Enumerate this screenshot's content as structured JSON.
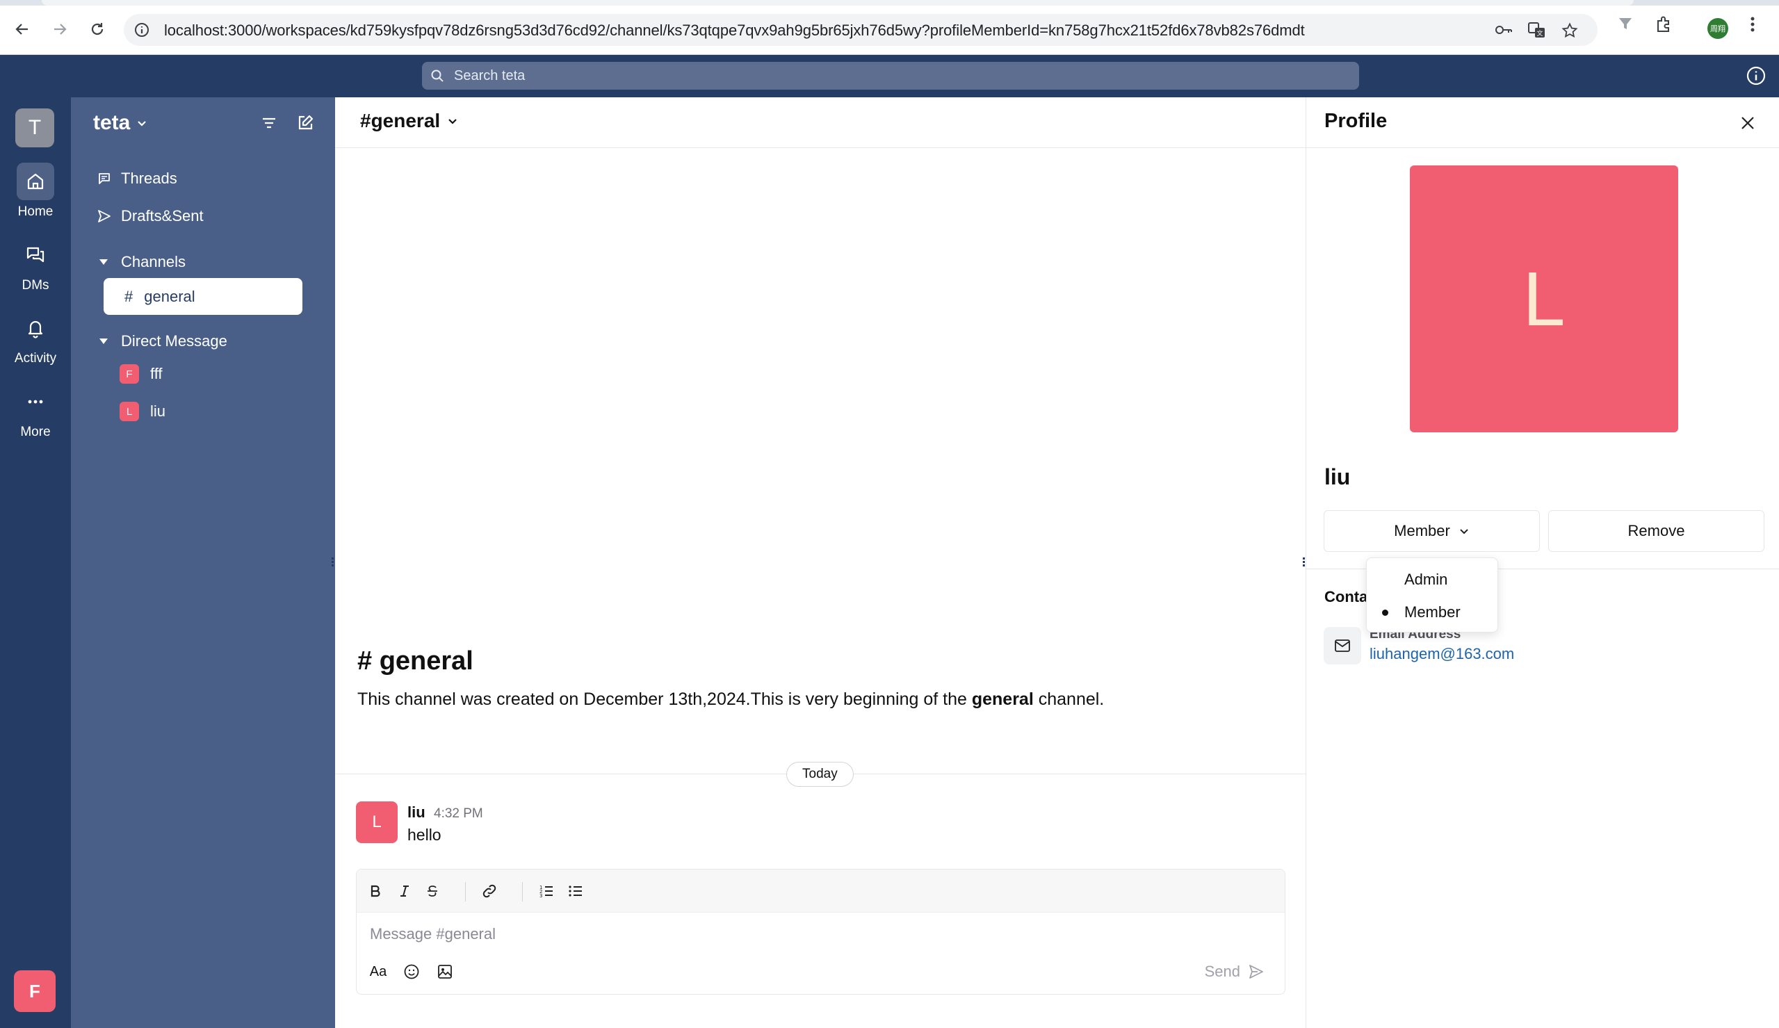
{
  "browser": {
    "url": "localhost:3000/workspaces/kd759kysfpqv78dz6rsng53d3d76cd92/channel/ks73qtqpe7qvx9ah9g5br65jxh76d5wy?profileMemberId=kn758g7hcx21t52fd6x78vb82s76dmdt",
    "profile_badge": "周翔"
  },
  "topbar": {
    "search_placeholder": "Search teta"
  },
  "rail": {
    "workspace_initial": "T",
    "items": [
      {
        "label": "Home",
        "icon": "home-icon"
      },
      {
        "label": "DMs",
        "icon": "chat-bubbles-icon"
      },
      {
        "label": "Activity",
        "icon": "bell-icon"
      },
      {
        "label": "More",
        "icon": "ellipsis-icon"
      }
    ],
    "user_initial": "F"
  },
  "sidebar": {
    "workspace_name": "teta",
    "links": [
      {
        "label": "Threads",
        "icon": "message-square-icon"
      },
      {
        "label": "Drafts&Sent",
        "icon": "send-icon"
      }
    ],
    "channels_label": "Channels",
    "channels": [
      {
        "prefix": "#",
        "name": "general"
      }
    ],
    "dm_label": "Direct Message",
    "dms": [
      {
        "initial": "F",
        "name": "fff"
      },
      {
        "initial": "L",
        "name": "liu"
      }
    ]
  },
  "main": {
    "title": "#general",
    "intro_title": "# general",
    "intro_before": "This channel was created on December 13th,2024.This is very beginning of the ",
    "intro_bold": "general",
    "intro_after": " channel.",
    "date_divider": "Today",
    "messages": [
      {
        "avatar_initial": "L",
        "author": "liu",
        "time": "4:32 PM",
        "text": "hello"
      }
    ],
    "editor": {
      "placeholder": "Message #general",
      "format_toggle": "Aa",
      "send_label": "Send"
    }
  },
  "profile": {
    "title": "Profile",
    "avatar_initial": "L",
    "name": "liu",
    "role_label": "Member",
    "remove_label": "Remove",
    "contact_title": "Conta",
    "email_label": "Email Address",
    "email_value": "liuhangem@163.com",
    "role_options": [
      {
        "label": "Admin",
        "selected": false
      },
      {
        "label": "Member",
        "selected": true
      }
    ]
  },
  "colors": {
    "navy": "#253c65",
    "sidebar": "#4a5f87",
    "accent_pink": "#f15e72",
    "link_blue": "#1d64ac"
  }
}
